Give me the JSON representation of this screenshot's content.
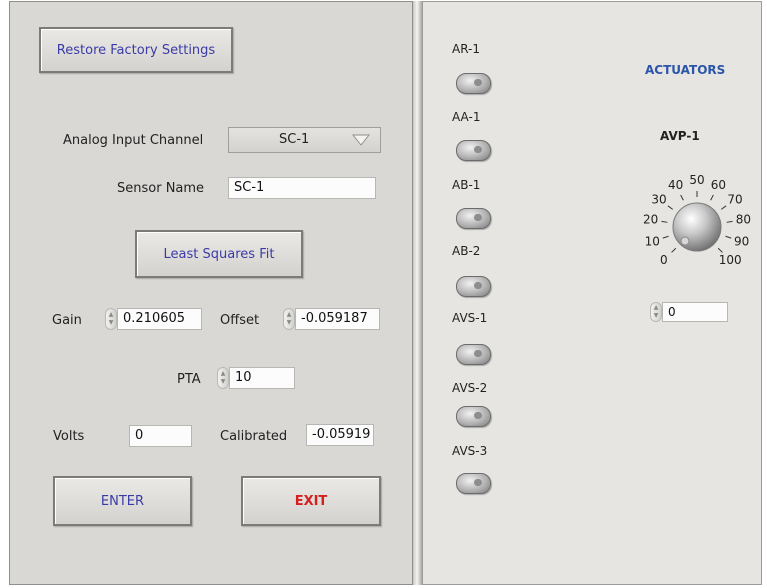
{
  "left": {
    "restore_button": "Restore Factory Settings",
    "analog_label": "Analog Input Channel",
    "analog_value": "SC-1",
    "sensor_label": "Sensor Name",
    "sensor_value": "SC-1",
    "lsq_button": "Least Squares  Fit",
    "gain_label": "Gain",
    "gain_value": "0.210605",
    "offset_label": "Offset",
    "offset_value": "-0.059187",
    "pta_label": "PTA",
    "pta_value": "10",
    "volts_label": "Volts",
    "volts_value": "0",
    "calibrated_label": "Calibrated",
    "calibrated_value": "-0.05919",
    "enter_button": "ENTER",
    "exit_button": "EXIT"
  },
  "right": {
    "toggles": [
      "AR-1",
      "AA-1",
      "AB-1",
      "AB-2",
      "AVS-1",
      "AVS-2",
      "AVS-3"
    ],
    "actuators_title": "ACTUATORS",
    "knob": {
      "label": "AVP-1",
      "ticks": [
        "0",
        "10",
        "20",
        "30",
        "40",
        "50",
        "60",
        "70",
        "80",
        "90",
        "100"
      ],
      "value": "0"
    }
  },
  "colors": {
    "button_text": "#3a3ba8",
    "exit_text": "#d42020",
    "actuators_title": "#2b55a8"
  }
}
